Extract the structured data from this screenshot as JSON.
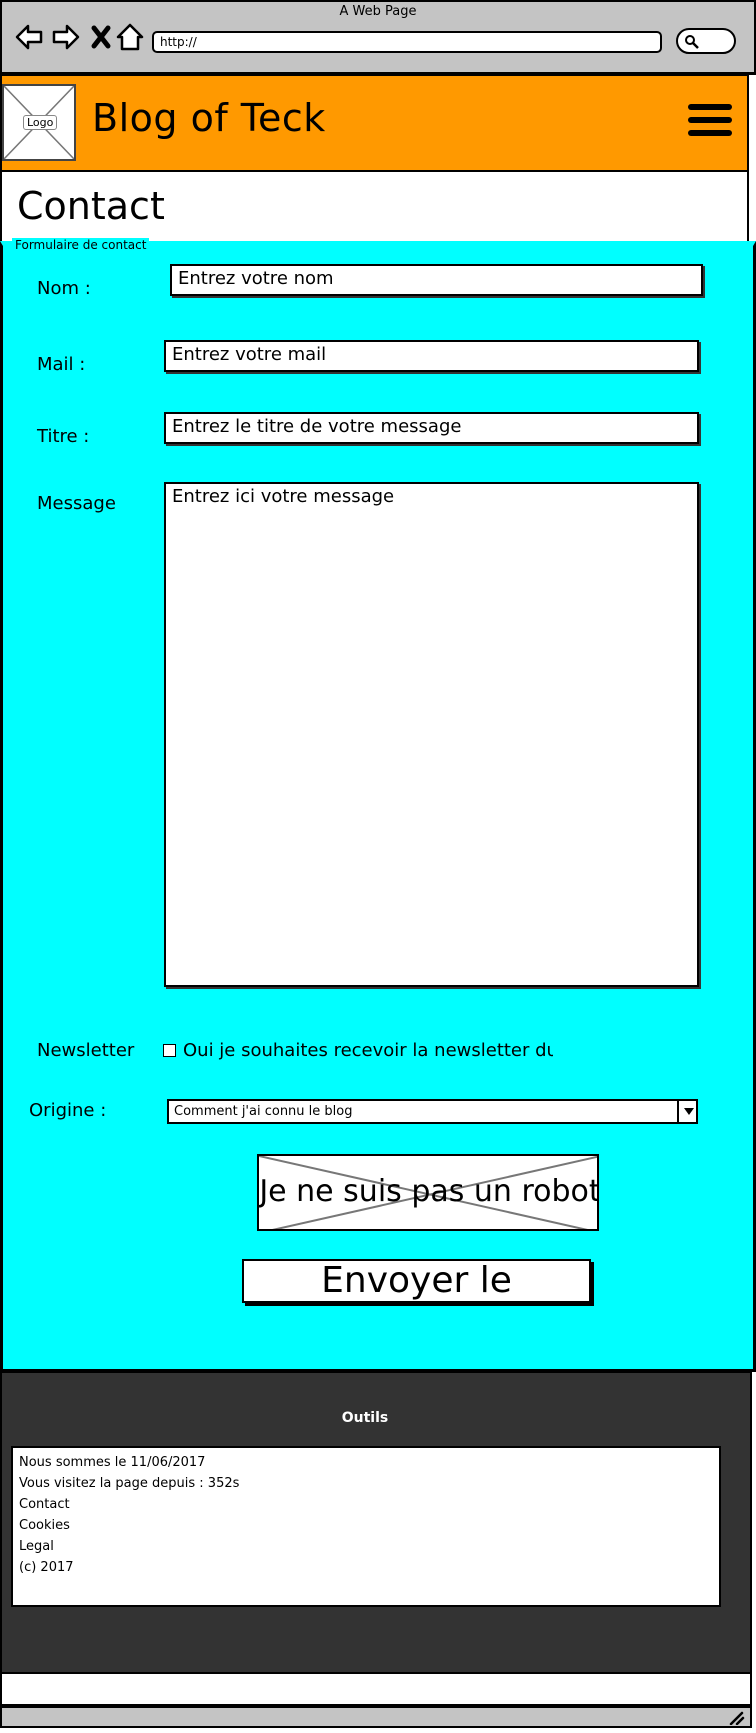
{
  "browser": {
    "window_title": "A Web Page",
    "url": "http://"
  },
  "header": {
    "logo_label": "Logo",
    "blog_title": "Blog of Teck"
  },
  "page": {
    "title": "Contact"
  },
  "form": {
    "legend": "Formulaire de contact",
    "nom_label": "Nom :",
    "nom_value": "Entrez votre nom",
    "mail_label": "Mail :",
    "mail_value": "Entrez votre mail",
    "titre_label": "Titre :",
    "titre_value": "Entrez le titre de votre message",
    "message_label": "Message",
    "message_value": "Entrez ici votre message",
    "newsletter_label": "Newsletter",
    "newsletter_checkbox": "Oui je souhaites recevoir la newsletter du blog",
    "origine_label": "Origine :",
    "origine_selected": "Comment j'ai connu le blog",
    "captcha_text": "Je ne suis pas un robot",
    "submit_label": "Envoyer le"
  },
  "footer": {
    "title": "Outils",
    "lines": [
      "Nous sommes le 11/06/2017",
      "Vous visitez la page depuis : 352s",
      "Contact",
      "Cookies",
      "Legal",
      "(c) 2017"
    ]
  },
  "colors": {
    "header_bg": "#ff9900",
    "form_bg": "#00ffff",
    "footer_bg": "#333333",
    "chrome_bg": "#c4c4c4"
  }
}
